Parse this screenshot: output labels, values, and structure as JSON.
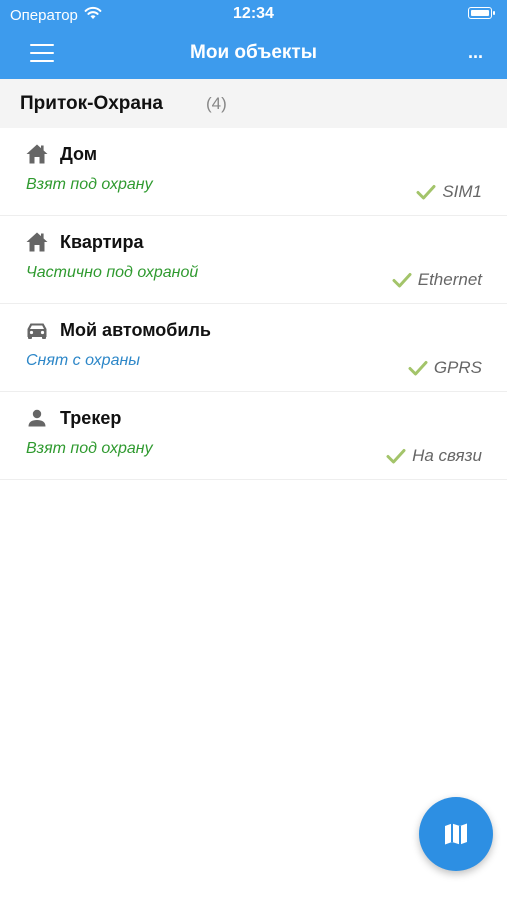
{
  "status_bar": {
    "carrier": "Оператор",
    "time": "12:34",
    "wifi_icon": "wifi-icon",
    "battery_icon": "battery-icon"
  },
  "navbar": {
    "title": "Мои объекты",
    "more_label": "...",
    "menu_icon": "hamburger-menu-icon",
    "background_color": "#3d9bed"
  },
  "group": {
    "title": "Приток-Охрана",
    "count": "(4)"
  },
  "objects": [
    {
      "icon": "house-icon",
      "name": "Дом",
      "status": "Взят под охрану",
      "status_color": "#2f9a2f",
      "connection": "SIM1",
      "connection_icon": "check-icon"
    },
    {
      "icon": "house-icon",
      "name": "Квартира",
      "status": "Частично под охраной",
      "status_color": "#2f9a2f",
      "connection": "Ethernet",
      "connection_icon": "check-icon"
    },
    {
      "icon": "car-icon",
      "name": "Мой автомобиль",
      "status": "Снят с охраны",
      "status_color": "#2d87c8",
      "connection": "GPRS",
      "connection_icon": "check-icon"
    },
    {
      "icon": "person-icon",
      "name": "Трекер",
      "status": "Взят под охрану",
      "status_color": "#2f9a2f",
      "connection": "На связи",
      "connection_icon": "check-icon"
    }
  ],
  "fab": {
    "icon": "map-icon",
    "color": "#2d8fe3"
  },
  "colors": {
    "check": "#a3c46a"
  }
}
